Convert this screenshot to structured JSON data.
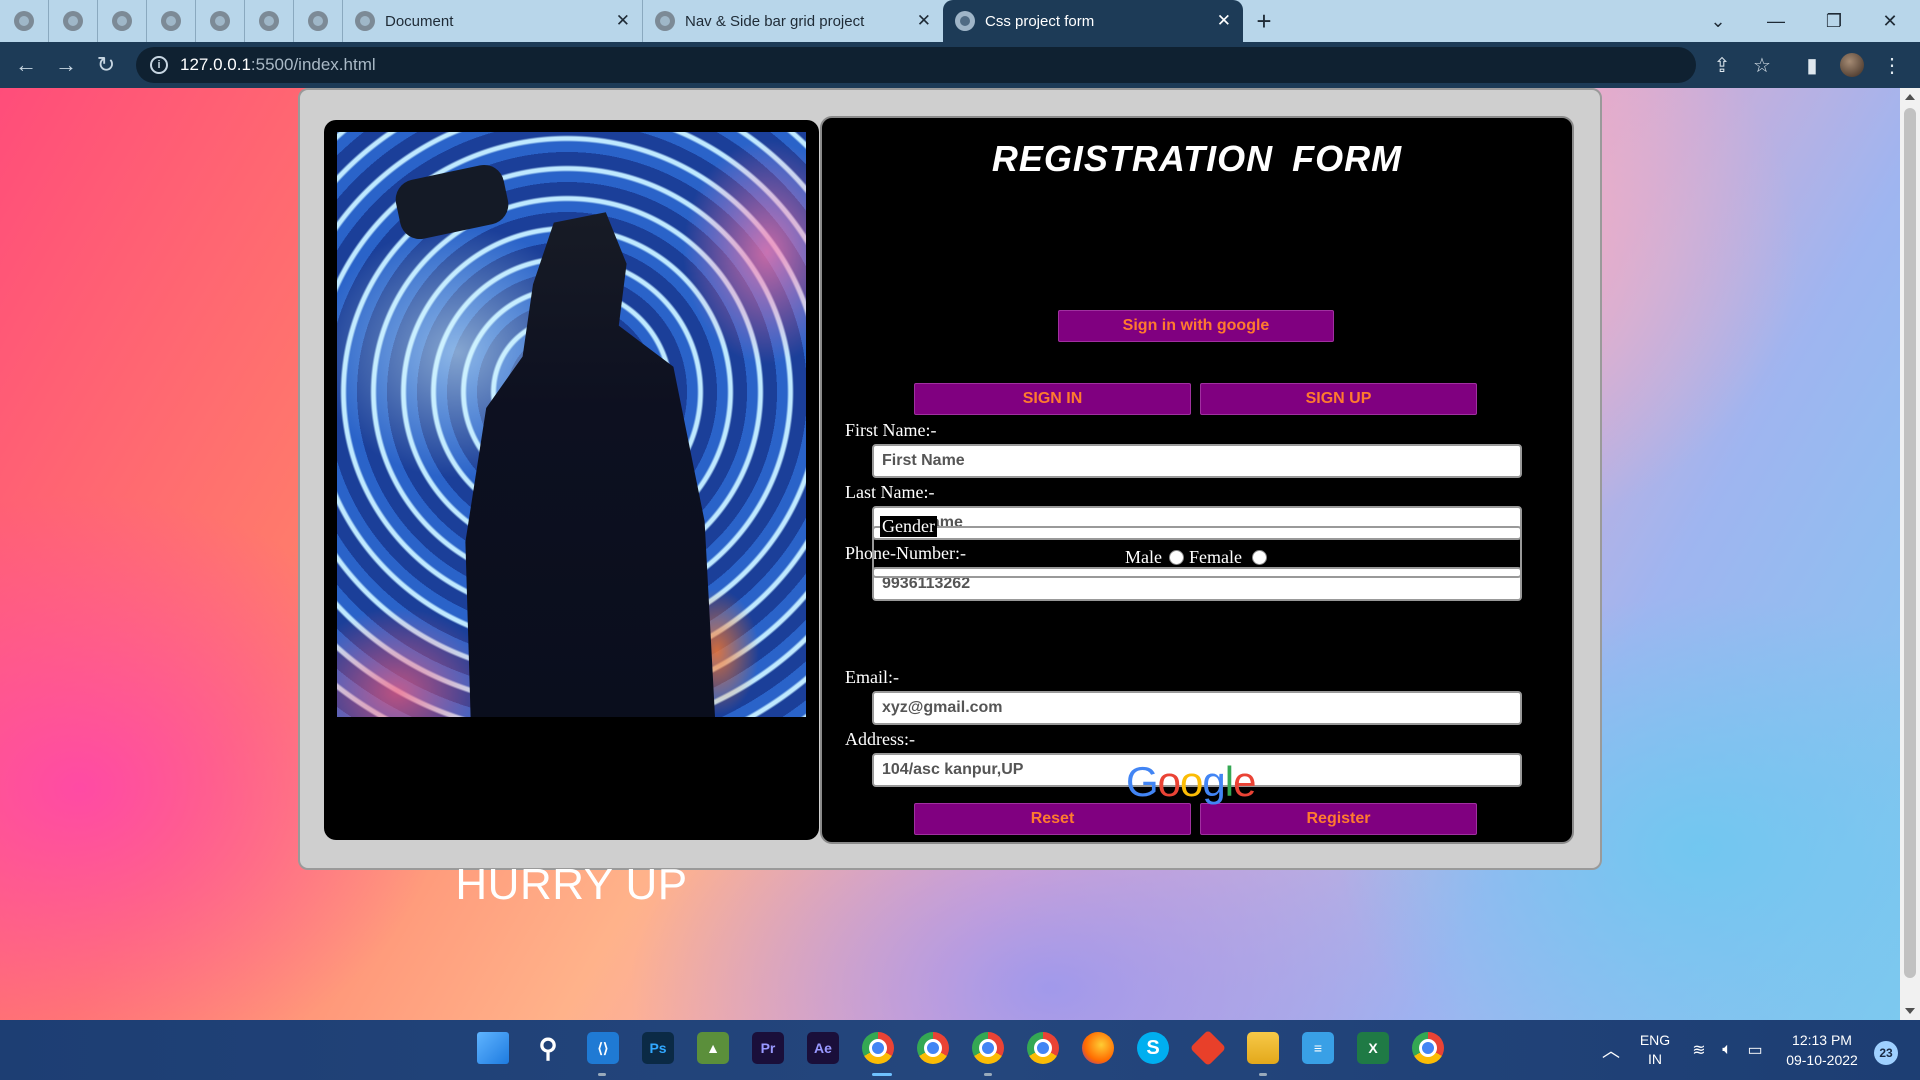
{
  "browser": {
    "tabs": [
      {
        "title": "Document",
        "active": false
      },
      {
        "title": "Nav & Side bar grid project",
        "active": false
      },
      {
        "title": "Css project form",
        "active": true
      }
    ],
    "url_host": "127.0.0.1",
    "url_path": ":5500/index.html"
  },
  "page": {
    "banner_text": "HURRY UP",
    "form_title": "REGISTRATION  FORM",
    "google_button": "Sign in with google",
    "sign_in": "SIGN IN",
    "sign_up": "SIGN UP",
    "fields": {
      "first_name": {
        "label": "First Name:-",
        "placeholder": "First Name",
        "value": ""
      },
      "last_name": {
        "label": "Last Name:-",
        "placeholder": "Last Name",
        "value": ""
      },
      "phone": {
        "label": "Phone-Number:-",
        "value": "9936113262"
      },
      "email": {
        "label": "Email:-",
        "value": "xyz@gmail.com"
      },
      "address": {
        "label": "Address:-",
        "value": "104/asc kanpur,UP"
      }
    },
    "gender": {
      "legend": "Gender",
      "male": "Male",
      "female": "Female"
    },
    "reset": "Reset",
    "register": "Register",
    "google_logo": [
      "G",
      "o",
      "o",
      "g",
      "l",
      "e"
    ],
    "google_colors": [
      "#4285F4",
      "#EA4335",
      "#FBBC05",
      "#4285F4",
      "#34A853",
      "#EA4335"
    ]
  },
  "taskbar": {
    "lang": "ENG",
    "region": "IN",
    "time": "12:13 PM",
    "date": "09-10-2022",
    "notifications": "23"
  }
}
